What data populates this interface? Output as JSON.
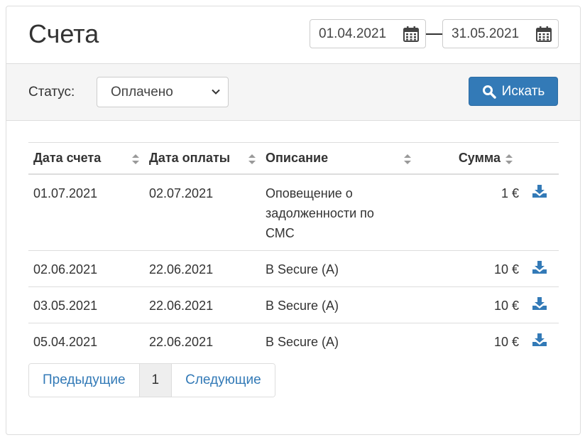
{
  "header": {
    "title": "Счета",
    "date_from": "01.04.2021",
    "date_to": "31.05.2021"
  },
  "filter": {
    "status_label": "Статус:",
    "status_value": "Оплачено",
    "search_label": "Искать"
  },
  "table": {
    "columns": [
      "Дата счета",
      "Дата оплаты",
      "Описание",
      "Сумма"
    ],
    "rows": [
      {
        "invoice_date": "01.07.2021",
        "paid_date": "02.07.2021",
        "description": "Оповещение о задолженности по СМС",
        "amount": "1 €"
      },
      {
        "invoice_date": "02.06.2021",
        "paid_date": "22.06.2021",
        "description": "B Secure (A)",
        "amount": "10 €"
      },
      {
        "invoice_date": "03.05.2021",
        "paid_date": "22.06.2021",
        "description": "B Secure (A)",
        "amount": "10 €"
      },
      {
        "invoice_date": "05.04.2021",
        "paid_date": "22.06.2021",
        "description": "B Secure (A)",
        "amount": "10 €"
      }
    ]
  },
  "pagination": {
    "prev": "Предыдущие",
    "current": "1",
    "next": "Следующие"
  },
  "icons": {
    "calendar": "calendar-icon",
    "search": "search-icon",
    "sort": "sort-icon",
    "download": "download-icon",
    "chevron": "chevron-down-icon"
  },
  "colors": {
    "primary": "#337ab7",
    "filter_bg": "#f5f5f5",
    "border": "#dddddd"
  }
}
